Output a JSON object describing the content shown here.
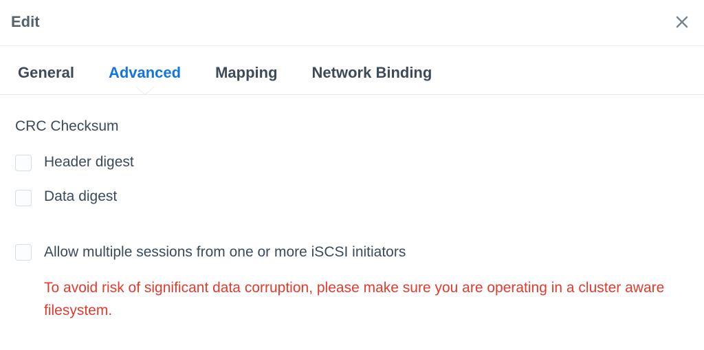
{
  "dialog": {
    "title": "Edit"
  },
  "tabs": {
    "general": {
      "label": "General"
    },
    "advanced": {
      "label": "Advanced"
    },
    "mapping": {
      "label": "Mapping"
    },
    "network": {
      "label": "Network Binding"
    },
    "active": "advanced"
  },
  "section": {
    "crc_label": "CRC Checksum"
  },
  "options": {
    "header_digest": {
      "label": "Header digest",
      "checked": false
    },
    "data_digest": {
      "label": "Data digest",
      "checked": false
    },
    "multi_session": {
      "label": "Allow multiple sessions from one or more iSCSI initiators",
      "checked": false
    }
  },
  "warning": {
    "text": "To avoid risk of significant data corruption, please make sure you are operating in a cluster aware filesystem."
  }
}
